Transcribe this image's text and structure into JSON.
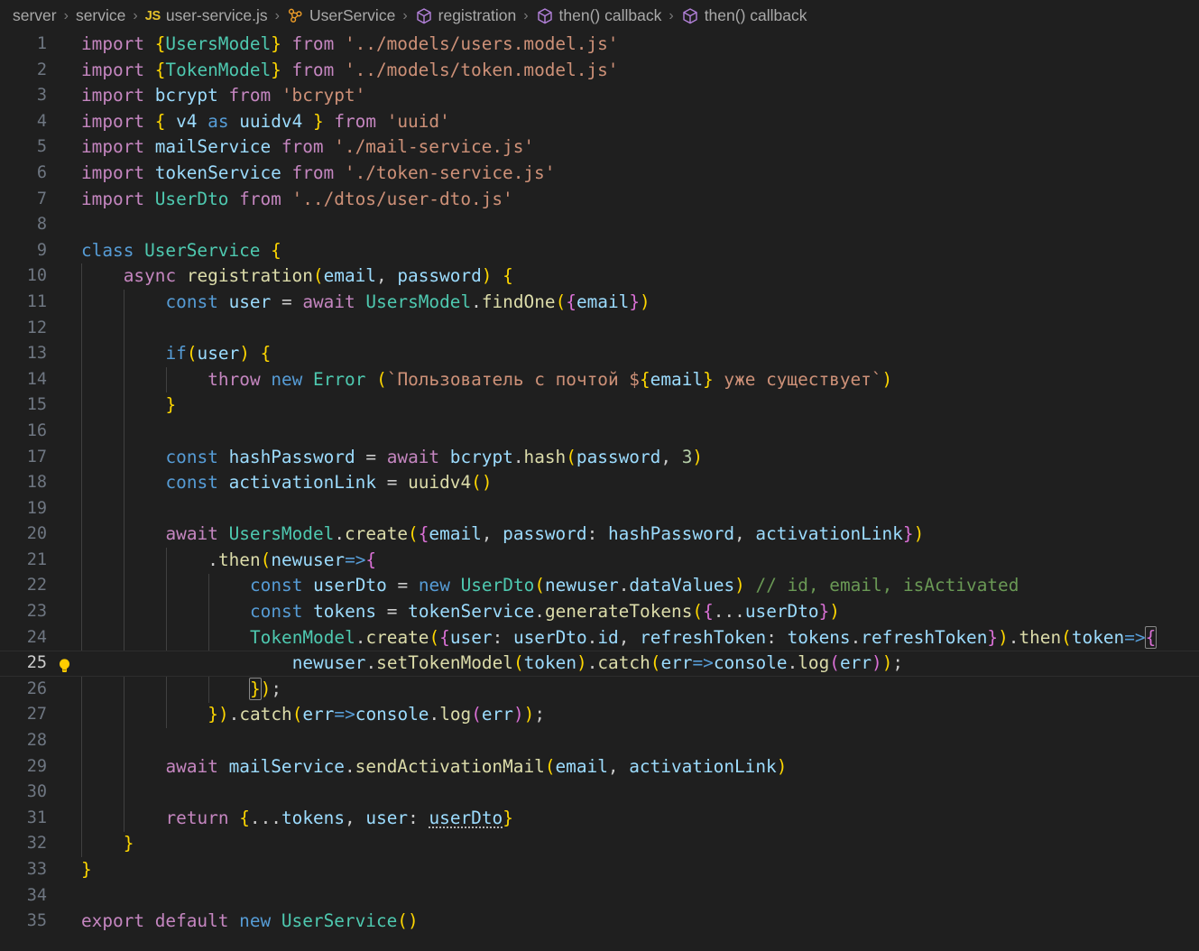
{
  "breadcrumb": {
    "separator": "›",
    "items": [
      {
        "label": "server",
        "icon": "none"
      },
      {
        "label": "service",
        "icon": "none"
      },
      {
        "label": "user-service.js",
        "icon": "js-file-icon"
      },
      {
        "label": "UserService",
        "icon": "class-symbol-icon"
      },
      {
        "label": "registration",
        "icon": "method-symbol-icon"
      },
      {
        "label": "then() callback",
        "icon": "method-symbol-icon"
      },
      {
        "label": "then() callback",
        "icon": "method-symbol-icon"
      }
    ]
  },
  "editor": {
    "active_line": 25,
    "quickfix_icon": "lightbulb-icon",
    "colors": {
      "background": "#1f1f1f",
      "line_number": "#6e7681",
      "active_line_number": "#cccccc",
      "keyword_pink": "#c586c0",
      "keyword_blue": "#569cd6",
      "identifier": "#9cdcfe",
      "string": "#ce9178",
      "function": "#dcdcaa",
      "class": "#4ec9b0",
      "number": "#b5cea8",
      "comment": "#6a9955",
      "bracket_1": "#ffd700",
      "bracket_2": "#da70d6",
      "bracket_3": "#179fff",
      "indent_guide": "#404040"
    },
    "lines": [
      {
        "n": 1,
        "text": "import {UsersModel} from '../models/users.model.js'"
      },
      {
        "n": 2,
        "text": "import {TokenModel} from '../models/token.model.js'"
      },
      {
        "n": 3,
        "text": "import bcrypt from 'bcrypt'"
      },
      {
        "n": 4,
        "text": "import { v4 as uuidv4 } from 'uuid'"
      },
      {
        "n": 5,
        "text": "import mailService from './mail-service.js'"
      },
      {
        "n": 6,
        "text": "import tokenService from './token-service.js'"
      },
      {
        "n": 7,
        "text": "import UserDto from '../dtos/user-dto.js'"
      },
      {
        "n": 8,
        "text": ""
      },
      {
        "n": 9,
        "text": "class UserService {"
      },
      {
        "n": 10,
        "text": "    async registration(email, password) {"
      },
      {
        "n": 11,
        "text": "        const user = await UsersModel.findOne({email})"
      },
      {
        "n": 12,
        "text": ""
      },
      {
        "n": 13,
        "text": "        if(user) {"
      },
      {
        "n": 14,
        "text": "            throw new Error (`Пользователь с почтой ${email} уже существует`)"
      },
      {
        "n": 15,
        "text": "        }"
      },
      {
        "n": 16,
        "text": ""
      },
      {
        "n": 17,
        "text": "        const hashPassword = await bcrypt.hash(password, 3)"
      },
      {
        "n": 18,
        "text": "        const activationLink = uuidv4()"
      },
      {
        "n": 19,
        "text": ""
      },
      {
        "n": 20,
        "text": "        await UsersModel.create({email, password: hashPassword, activationLink})"
      },
      {
        "n": 21,
        "text": "            .then(newuser=>{"
      },
      {
        "n": 22,
        "text": "                const userDto = new UserDto(newuser.dataValues) // id, email, isActivated"
      },
      {
        "n": 23,
        "text": "                const tokens = tokenService.generateTokens({...userDto})"
      },
      {
        "n": 24,
        "text": "                TokenModel.create({user: userDto.id, refreshToken: tokens.refreshToken}).then(token=>{"
      },
      {
        "n": 25,
        "text": "                    newuser.setTokenModel(token).catch(err=>console.log(err));"
      },
      {
        "n": 26,
        "text": "                });"
      },
      {
        "n": 27,
        "text": "            }).catch(err=>console.log(err));"
      },
      {
        "n": 28,
        "text": ""
      },
      {
        "n": 29,
        "text": "        await mailService.sendActivationMail(email, activationLink)"
      },
      {
        "n": 30,
        "text": ""
      },
      {
        "n": 31,
        "text": "        return {...tokens, user: userDto}"
      },
      {
        "n": 32,
        "text": "    }"
      },
      {
        "n": 33,
        "text": "}"
      },
      {
        "n": 34,
        "text": ""
      },
      {
        "n": 35,
        "text": "export default new UserService()"
      }
    ]
  }
}
